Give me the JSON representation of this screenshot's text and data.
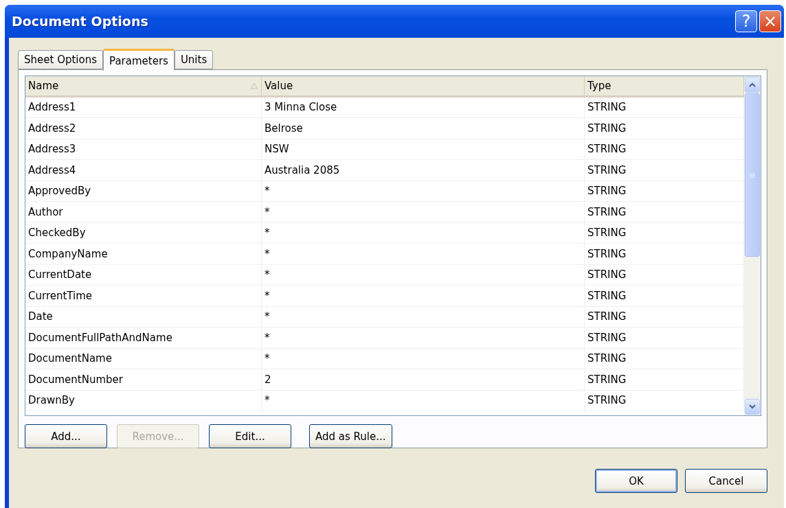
{
  "window": {
    "title": "Document Options",
    "title_buttons": [
      {
        "kind": "help",
        "label": "?"
      },
      {
        "kind": "close",
        "label": "×"
      }
    ]
  },
  "tabs": [
    {
      "label": "Sheet Options",
      "selected": false
    },
    {
      "label": "Parameters",
      "selected": true
    },
    {
      "label": "Units",
      "selected": false
    }
  ],
  "table": {
    "columns": [
      {
        "label": "Name",
        "sorted": true
      },
      {
        "label": "Value",
        "sorted": false
      },
      {
        "label": "Type",
        "sorted": false
      }
    ],
    "rows": [
      [
        "Address1",
        "3 Minna Close",
        "STRING"
      ],
      [
        "Address2",
        "Belrose",
        "STRING"
      ],
      [
        "Address3",
        "NSW",
        "STRING"
      ],
      [
        "Address4",
        "Australia 2085",
        "STRING"
      ],
      [
        "ApprovedBy",
        "*",
        "STRING"
      ],
      [
        "Author",
        "*",
        "STRING"
      ],
      [
        "CheckedBy",
        "*",
        "STRING"
      ],
      [
        "CompanyName",
        "*",
        "STRING"
      ],
      [
        "CurrentDate",
        "*",
        "STRING"
      ],
      [
        "CurrentTime",
        "*",
        "STRING"
      ],
      [
        "Date",
        "*",
        "STRING"
      ],
      [
        "DocumentFullPathAndName",
        "*",
        "STRING"
      ],
      [
        "DocumentName",
        "*",
        "STRING"
      ],
      [
        "DocumentNumber",
        "2",
        "STRING"
      ],
      [
        "DrawnBy",
        "*",
        "STRING"
      ]
    ]
  },
  "panel_buttons": [
    {
      "label": "Add...",
      "disabled": false
    },
    {
      "label": "Remove...",
      "disabled": true
    },
    {
      "label": "Edit...",
      "disabled": false
    },
    {
      "label": "Add as Rule...",
      "disabled": false
    }
  ],
  "dialog_buttons": [
    {
      "label": "OK",
      "default": true
    },
    {
      "label": "Cancel",
      "default": false
    }
  ]
}
